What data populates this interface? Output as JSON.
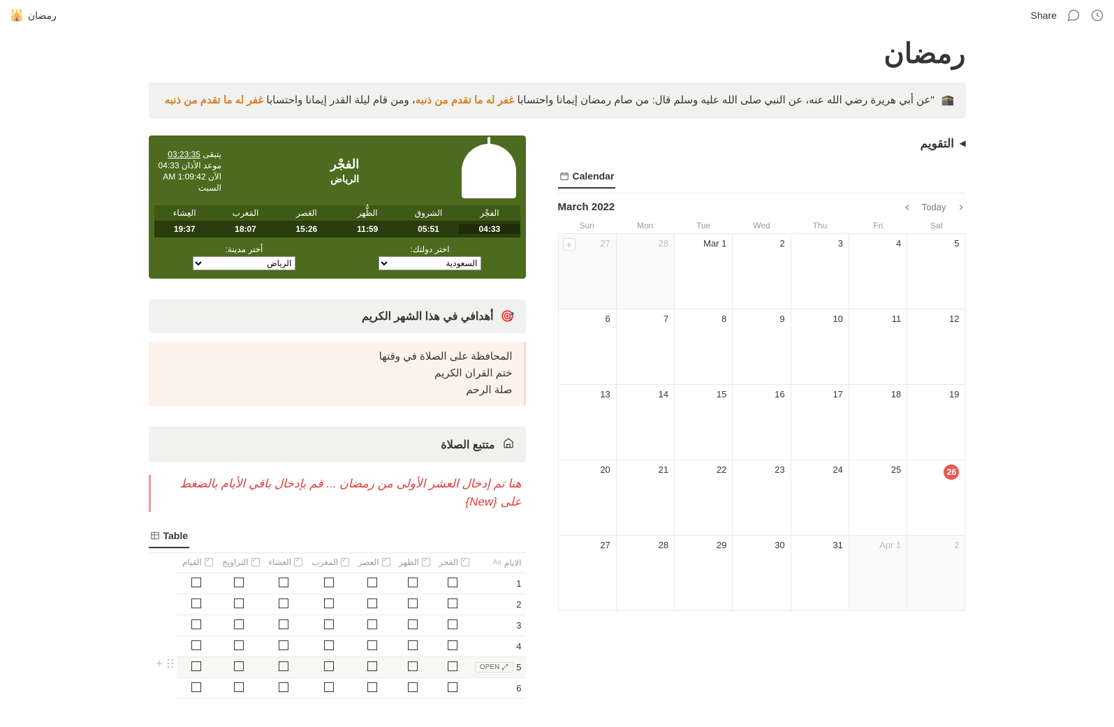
{
  "topbar": {
    "breadcrumb_icon": "🕌",
    "breadcrumb": "رمضان",
    "share": "Share"
  },
  "page": {
    "title": "رمضان"
  },
  "hadith": {
    "icon": "🕋",
    "text_pre": "\"عن أبي هريرة رضي الله عنه، عن النبي صلى الله عليه وسلم قال: من صام رمضان إيمانا واحتسابا ",
    "highlight1": "غفر له ما تقدم من ذنبه",
    "text_mid": "، ومن قام ليلة القدر إيمانا واحتسابا ",
    "highlight2": "غفر له ما تقدم من ذنبه"
  },
  "prayer": {
    "next_label": "الفجْر",
    "city": "الرياض",
    "remain_label": "يتبقى",
    "remain_time": "03:23:35",
    "adhan_label": "موعد الأذان",
    "adhan_time": "04:33",
    "now_label": "الآن",
    "now_time": "1:09:42 AM",
    "day": "السبت",
    "names": [
      "العِشاء",
      "المَغرب",
      "العَصر",
      "الظُّهر",
      "الشروق",
      "الفجْر"
    ],
    "times": [
      "19:37",
      "18:07",
      "15:26",
      "11:59",
      "05:51",
      "04:33"
    ],
    "active_index": 5,
    "country_label": "اختر دولتك:",
    "country_value": "السعودية",
    "city_label": "أختر مدينة:",
    "city_value": "الرياض"
  },
  "goals": {
    "header_icon": "🎯",
    "header": "أهدافي في هذا الشهر الكريم",
    "items": [
      "المحافظة على الصلاة في وقتها",
      "ختم القران الكريم",
      "صلة الرحم"
    ]
  },
  "tracker": {
    "header_icon": "🕌",
    "header": "متتبع الصلاة",
    "note": "هنا تم إدخال العشر الأولى من رمضان ... قم بإدخال باقي الأيام بالضغط على",
    "note_suffix": "{New}",
    "tab": "Table",
    "columns": [
      "الايام",
      "الفجر",
      "الظهر",
      "العصر",
      "المغرب",
      "العشاء",
      "التراويح",
      "القيام"
    ],
    "rows": [
      "1",
      "2",
      "3",
      "4",
      "5",
      "6"
    ],
    "hover_row": 4,
    "open_label": "OPEN"
  },
  "calendar": {
    "toggle": "التقويم",
    "tab": "Calendar",
    "month": "March 2022",
    "today_label": "Today",
    "weekdays": [
      "Sun",
      "Mon",
      "Tue",
      "Wed",
      "Thu",
      "Fri",
      "Sat"
    ],
    "cells": [
      {
        "n": "27",
        "out": true,
        "add": true
      },
      {
        "n": "28",
        "out": true
      },
      {
        "n": "Mar 1"
      },
      {
        "n": "2"
      },
      {
        "n": "3"
      },
      {
        "n": "4"
      },
      {
        "n": "5"
      },
      {
        "n": "6"
      },
      {
        "n": "7"
      },
      {
        "n": "8"
      },
      {
        "n": "9"
      },
      {
        "n": "10"
      },
      {
        "n": "11"
      },
      {
        "n": "12"
      },
      {
        "n": "13"
      },
      {
        "n": "14"
      },
      {
        "n": "15"
      },
      {
        "n": "16"
      },
      {
        "n": "17"
      },
      {
        "n": "18"
      },
      {
        "n": "19"
      },
      {
        "n": "20"
      },
      {
        "n": "21"
      },
      {
        "n": "22"
      },
      {
        "n": "23"
      },
      {
        "n": "24"
      },
      {
        "n": "25"
      },
      {
        "n": "26",
        "today": true
      },
      {
        "n": "27"
      },
      {
        "n": "28"
      },
      {
        "n": "29"
      },
      {
        "n": "30"
      },
      {
        "n": "31"
      },
      {
        "n": "Apr 1",
        "out": true
      },
      {
        "n": "2",
        "out": true
      }
    ]
  }
}
